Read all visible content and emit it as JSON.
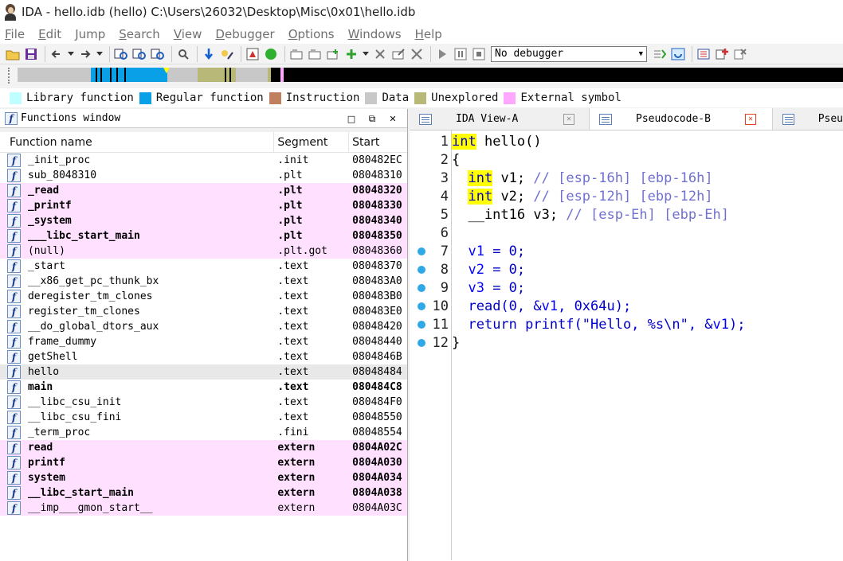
{
  "title": "IDA - hello.idb (hello) C:\\Users\\26032\\Desktop\\Misc\\0x01\\hello.idb",
  "menu": [
    "File",
    "Edit",
    "Jump",
    "Search",
    "View",
    "Debugger",
    "Options",
    "Windows",
    "Help"
  ],
  "menu_underline": [
    "F",
    "E",
    "J",
    "S",
    "V",
    "D",
    "O",
    "W",
    "H"
  ],
  "menu_rest": [
    "ile",
    "dit",
    "ump",
    "earch",
    "iew",
    "ebugger",
    "ptions",
    "indows",
    "elp"
  ],
  "toolbar": {
    "debugger_select": "No debugger"
  },
  "legend": [
    {
      "label": "Library function",
      "color": "#c0ffff"
    },
    {
      "label": "Regular function",
      "color": "#0aa0e8"
    },
    {
      "label": "Instruction",
      "color": "#c08060"
    },
    {
      "label": "Data",
      "color": "#c8c8c8"
    },
    {
      "label": "Unexplored",
      "color": "#b8b878"
    },
    {
      "label": "External symbol",
      "color": "#ffa8ff"
    }
  ],
  "functions_window": {
    "title": "Functions window",
    "columns": [
      "Function name",
      "Segment",
      "Start"
    ],
    "rows": [
      {
        "name": "_init_proc",
        "segment": ".init",
        "start": "080482EC",
        "kind": "normal"
      },
      {
        "name": "sub_8048310",
        "segment": ".plt",
        "start": "08048310",
        "kind": "normal"
      },
      {
        "name": "_read",
        "segment": ".plt",
        "start": "08048320",
        "kind": "extbold"
      },
      {
        "name": "_printf",
        "segment": ".plt",
        "start": "08048330",
        "kind": "extbold"
      },
      {
        "name": "_system",
        "segment": ".plt",
        "start": "08048340",
        "kind": "extbold"
      },
      {
        "name": "___libc_start_main",
        "segment": ".plt",
        "start": "08048350",
        "kind": "extbold"
      },
      {
        "name": "(null)",
        "segment": ".plt.got",
        "start": "08048360",
        "kind": "ext"
      },
      {
        "name": "_start",
        "segment": ".text",
        "start": "08048370",
        "kind": "normal"
      },
      {
        "name": "__x86_get_pc_thunk_bx",
        "segment": ".text",
        "start": "080483A0",
        "kind": "normal"
      },
      {
        "name": "deregister_tm_clones",
        "segment": ".text",
        "start": "080483B0",
        "kind": "normal"
      },
      {
        "name": "register_tm_clones",
        "segment": ".text",
        "start": "080483E0",
        "kind": "normal"
      },
      {
        "name": "__do_global_dtors_aux",
        "segment": ".text",
        "start": "08048420",
        "kind": "normal"
      },
      {
        "name": "frame_dummy",
        "segment": ".text",
        "start": "08048440",
        "kind": "normal"
      },
      {
        "name": "getShell",
        "segment": ".text",
        "start": "0804846B",
        "kind": "normal"
      },
      {
        "name": "hello",
        "segment": ".text",
        "start": "08048484",
        "kind": "selected"
      },
      {
        "name": "main",
        "segment": ".text",
        "start": "080484C8",
        "kind": "bold"
      },
      {
        "name": "__libc_csu_init",
        "segment": ".text",
        "start": "080484F0",
        "kind": "normal"
      },
      {
        "name": "__libc_csu_fini",
        "segment": ".text",
        "start": "08048550",
        "kind": "normal"
      },
      {
        "name": "_term_proc",
        "segment": ".fini",
        "start": "08048554",
        "kind": "normal"
      },
      {
        "name": "read",
        "segment": "extern",
        "start": "0804A02C",
        "kind": "extbold"
      },
      {
        "name": "printf",
        "segment": "extern",
        "start": "0804A030",
        "kind": "extbold"
      },
      {
        "name": "system",
        "segment": "extern",
        "start": "0804A034",
        "kind": "extbold"
      },
      {
        "name": "__libc_start_main",
        "segment": "extern",
        "start": "0804A038",
        "kind": "extbold"
      },
      {
        "name": "__imp___gmon_start__",
        "segment": "extern",
        "start": "0804A03C",
        "kind": "ext"
      }
    ]
  },
  "tabs": [
    {
      "label": "IDA View-A",
      "active": false
    },
    {
      "label": "Pseudocode-B",
      "active": true
    },
    {
      "label": "Pseu",
      "active": false
    }
  ],
  "code": {
    "lines": [
      {
        "n": "1",
        "bp": false,
        "parts": [
          [
            "kwint",
            "int"
          ],
          [
            "plain",
            " hello()"
          ]
        ]
      },
      {
        "n": "2",
        "bp": false,
        "parts": [
          [
            "plain",
            "{"
          ]
        ]
      },
      {
        "n": "3",
        "bp": false,
        "parts": [
          [
            "plain",
            "  "
          ],
          [
            "kwint",
            "int"
          ],
          [
            "plain",
            " v1; "
          ],
          [
            "cmt",
            "// [esp-16h] [ebp-16h]"
          ]
        ]
      },
      {
        "n": "4",
        "bp": false,
        "parts": [
          [
            "plain",
            "  "
          ],
          [
            "kwint",
            "int"
          ],
          [
            "plain",
            " v2; "
          ],
          [
            "cmt",
            "// [esp-12h] [ebp-12h]"
          ]
        ]
      },
      {
        "n": "5",
        "bp": false,
        "parts": [
          [
            "plain",
            "  __int16 v3; "
          ],
          [
            "cmt",
            "// [esp-Eh] [ebp-Eh]"
          ]
        ]
      },
      {
        "n": "6",
        "bp": false,
        "parts": [
          [
            "plain",
            ""
          ]
        ]
      },
      {
        "n": "7",
        "bp": true,
        "parts": [
          [
            "plain",
            "  "
          ],
          [
            "var",
            "v1"
          ],
          [
            "blue",
            " = 0;"
          ]
        ]
      },
      {
        "n": "8",
        "bp": true,
        "parts": [
          [
            "plain",
            "  "
          ],
          [
            "var",
            "v2"
          ],
          [
            "blue",
            " = 0;"
          ]
        ]
      },
      {
        "n": "9",
        "bp": true,
        "parts": [
          [
            "plain",
            "  "
          ],
          [
            "var",
            "v3"
          ],
          [
            "blue",
            " = 0;"
          ]
        ]
      },
      {
        "n": "10",
        "bp": true,
        "parts": [
          [
            "plain",
            "  "
          ],
          [
            "blue",
            "read(0, &"
          ],
          [
            "var",
            "v1"
          ],
          [
            "blue",
            ", 0x64u);"
          ]
        ]
      },
      {
        "n": "11",
        "bp": true,
        "parts": [
          [
            "plain",
            "  "
          ],
          [
            "blue",
            "return printf(\"Hello, %s\\n\", &"
          ],
          [
            "var",
            "v1"
          ],
          [
            "blue",
            ");"
          ]
        ]
      },
      {
        "n": "12",
        "bp": true,
        "parts": [
          [
            "plain",
            "}"
          ]
        ]
      }
    ]
  }
}
